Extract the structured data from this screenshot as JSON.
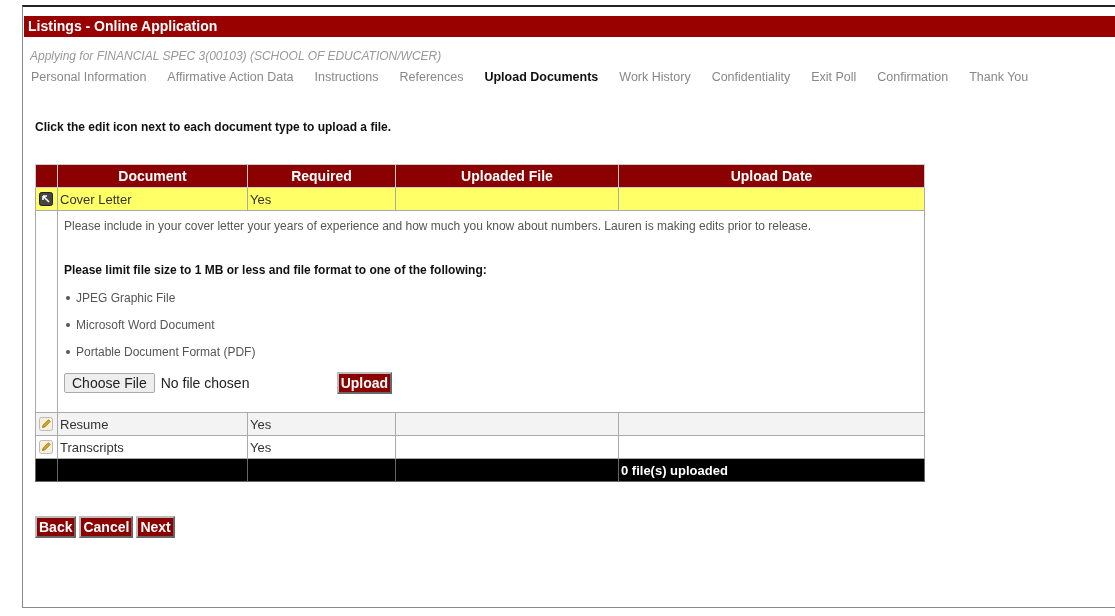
{
  "window": {
    "title": "Listings - Online Application"
  },
  "subtitle": "Applying for FINANCIAL SPEC 3(00103) (SCHOOL OF EDUCATION/WCER)",
  "steps": [
    {
      "label": "Personal Information",
      "selected": false
    },
    {
      "label": "Affirmative Action Data",
      "selected": false
    },
    {
      "label": "Instructions",
      "selected": false
    },
    {
      "label": "References",
      "selected": false
    },
    {
      "label": "Upload Documents",
      "selected": true
    },
    {
      "label": "Work History",
      "selected": false
    },
    {
      "label": "Confidentiality",
      "selected": false
    },
    {
      "label": "Exit Poll",
      "selected": false
    },
    {
      "label": "Confirmation",
      "selected": false
    },
    {
      "label": "Thank You",
      "selected": false
    }
  ],
  "instruction": "Click the edit icon next to each document type to upload a file.",
  "table": {
    "columns": [
      "Document",
      "Required",
      "Uploaded File",
      "Upload Date"
    ],
    "rows": [
      {
        "document": "Cover Letter",
        "required": "Yes",
        "expanded": true,
        "details": {
          "description": "Please include in your cover letter your years of experience and how much you know about numbers. Lauren is making edits prior to release.",
          "limit_note": "Please limit file size to 1 MB or less and file format to one of the following:",
          "formats": [
            "JPEG Graphic File",
            "Microsoft Word Document",
            "Portable Document Format (PDF)"
          ],
          "choose_file": "Choose File",
          "file_status": "No file chosen",
          "upload": "Upload"
        }
      },
      {
        "document": "Resume",
        "required": "Yes",
        "expanded": false
      },
      {
        "document": "Transcripts",
        "required": "Yes",
        "expanded": false
      }
    ],
    "footer": "0 file(s) uploaded"
  },
  "buttons": [
    "Back",
    "Cancel",
    "Next"
  ]
}
